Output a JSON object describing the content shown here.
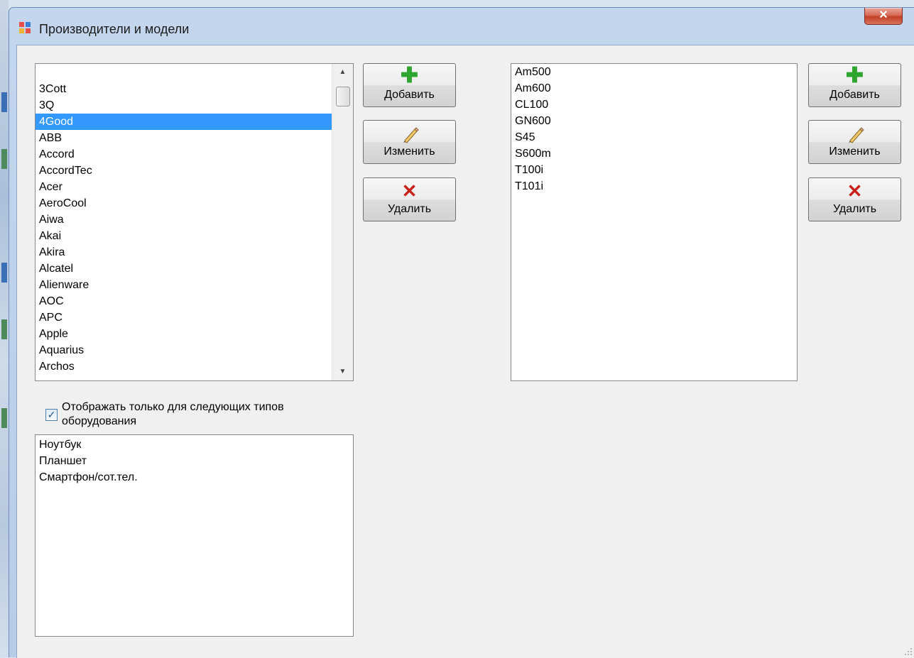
{
  "window": {
    "title": "Производители и модели",
    "close_glyph": "✕"
  },
  "manufacturers": {
    "items": [
      "3Cott",
      "3Q",
      "4Good",
      "ABB",
      "Accord",
      "AccordTec",
      "Acer",
      "AeroCool",
      "Aiwa",
      "Akai",
      "Akira",
      "Alcatel",
      "Alienware",
      "AOC",
      "APC",
      "Apple",
      "Aquarius",
      "Archos"
    ],
    "selected": "4Good",
    "scroll_up": "▲",
    "scroll_down": "▼"
  },
  "manufacturer_buttons": {
    "add": {
      "label": "Добавить",
      "icon": "plus-icon",
      "glyph": "✚"
    },
    "edit": {
      "label": "Изменить",
      "icon": "pencil-icon"
    },
    "delete": {
      "label": "Удалить",
      "icon": "delete-x-icon",
      "glyph": "✕"
    }
  },
  "models": {
    "items": [
      "Am500",
      "Am600",
      "CL100",
      "GN600",
      "S45",
      "S600m",
      "T100i",
      "T101i"
    ]
  },
  "model_buttons": {
    "add": {
      "label": "Добавить",
      "icon": "plus-icon",
      "glyph": "✚"
    },
    "edit": {
      "label": "Изменить",
      "icon": "pencil-icon"
    },
    "delete": {
      "label": "Удалить",
      "icon": "delete-x-icon",
      "glyph": "✕"
    }
  },
  "filter": {
    "checked": true,
    "check_glyph": "✓",
    "label": "Отображать только для следующих типов оборудования"
  },
  "equipment_types": {
    "items": [
      "Ноутбук",
      "Планшет",
      "Смартфон/сот.тел."
    ]
  },
  "colors": {
    "selection": "#3399ff",
    "add_icon": "#2ea52e",
    "delete_icon": "#c8221b",
    "close_button": "#c34028"
  }
}
